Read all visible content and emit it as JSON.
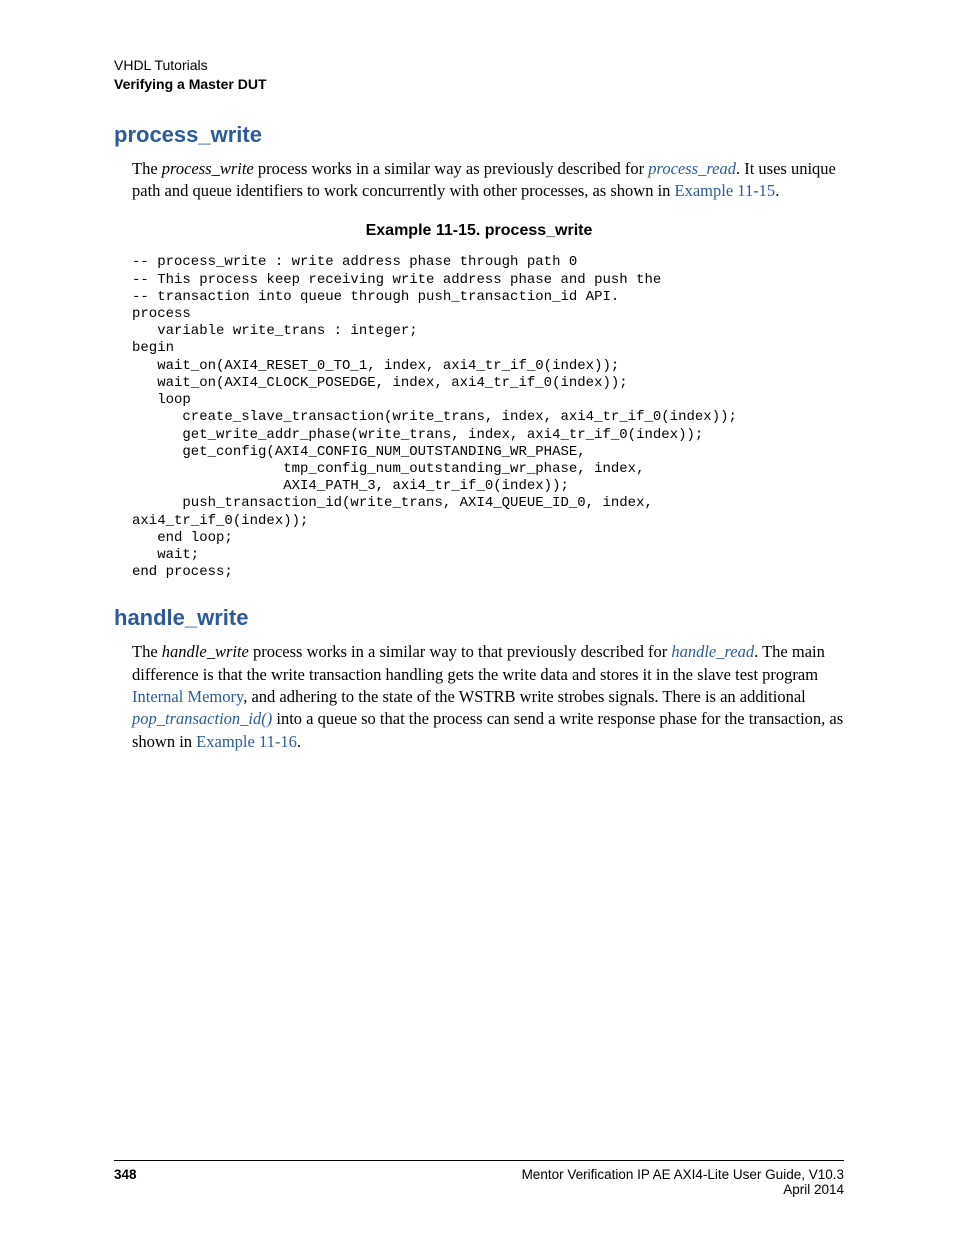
{
  "header": {
    "line1": "VHDL Tutorials",
    "line2": "Verifying a Master DUT"
  },
  "section1": {
    "title": "process_write",
    "para": {
      "t1": "The ",
      "em1": "process_write",
      "t2": " process works in a similar way as previously described for ",
      "link1": "process_read",
      "t3": ". It uses unique path and queue identifiers to work concurrently with other processes, as shown in ",
      "link2": "Example 11-15",
      "t4": "."
    },
    "example_title": "Example 11-15. process_write",
    "code": "-- process_write : write address phase through path 0\n-- This process keep receiving write address phase and push the\n-- transaction into queue through push_transaction_id API.\nprocess\n   variable write_trans : integer;\nbegin\n   wait_on(AXI4_RESET_0_TO_1, index, axi4_tr_if_0(index));\n   wait_on(AXI4_CLOCK_POSEDGE, index, axi4_tr_if_0(index));\n   loop\n      create_slave_transaction(write_trans, index, axi4_tr_if_0(index));\n      get_write_addr_phase(write_trans, index, axi4_tr_if_0(index));\n      get_config(AXI4_CONFIG_NUM_OUTSTANDING_WR_PHASE,\n                  tmp_config_num_outstanding_wr_phase, index,\n                  AXI4_PATH_3, axi4_tr_if_0(index));\n      push_transaction_id(write_trans, AXI4_QUEUE_ID_0, index,\naxi4_tr_if_0(index));\n   end loop;\n   wait;\nend process;"
  },
  "section2": {
    "title": "handle_write",
    "para": {
      "t1": "The ",
      "em1": "handle_write",
      "t2": " process works in a similar way to that previously described for ",
      "link1": "handle_read",
      "t3": ". The main difference is that the write transaction handling gets the write data and stores it in the slave test program ",
      "link2": "Internal Memory",
      "t4": ", and adhering to the state of the WSTRB write strobes signals. There is an additional ",
      "link3": "pop_transaction_id()",
      "t5": " into a queue so that the  process can send a write response phase for the transaction, as shown in ",
      "link4": "Example 11-16",
      "t6": "."
    }
  },
  "footer": {
    "page": "348",
    "guide": "Mentor Verification IP AE AXI4-Lite User Guide, V10.3",
    "date": "April 2014"
  }
}
